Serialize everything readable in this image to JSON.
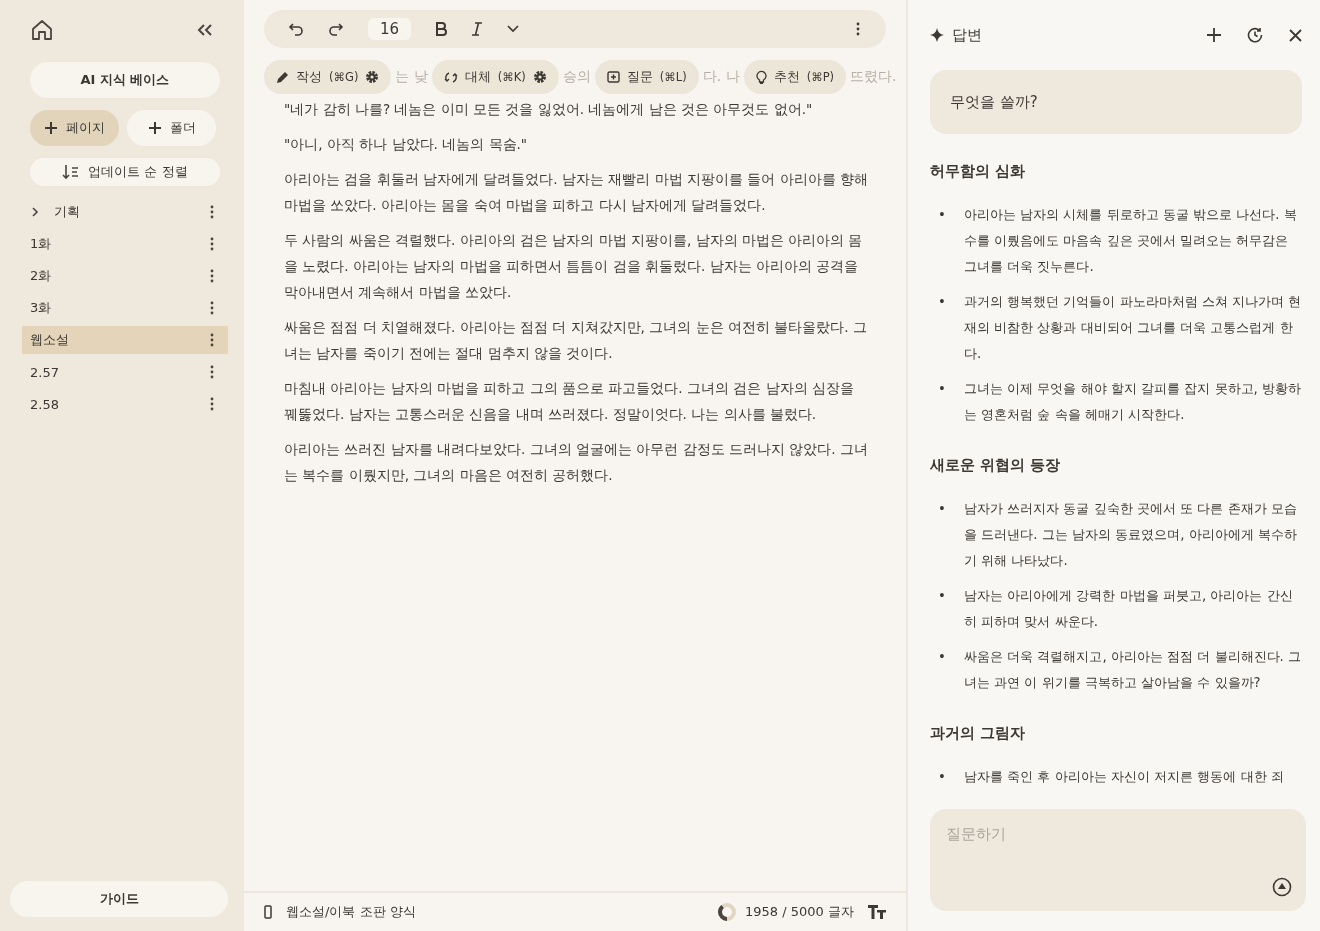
{
  "sidebar": {
    "knowledge_base_button": "AI 지식 베이스",
    "new_buttons": [
      {
        "label": "페이지",
        "selected": true
      },
      {
        "label": "폴더",
        "selected": false
      }
    ],
    "sort_button": "업데이트 순 정렬",
    "items": [
      {
        "kind": "folder",
        "label": "기획",
        "expanded": false,
        "selected": false
      },
      {
        "kind": "page",
        "label": "1화",
        "selected": false
      },
      {
        "kind": "page",
        "label": "2화",
        "selected": false
      },
      {
        "kind": "page",
        "label": "3화",
        "selected": false
      },
      {
        "kind": "page",
        "label": "웹소설",
        "selected": true
      },
      {
        "kind": "page",
        "label": "2.57",
        "selected": false
      },
      {
        "kind": "page",
        "label": "2.58",
        "selected": false
      }
    ],
    "guide_button": "가이드"
  },
  "toolbar": {
    "font_size": "16"
  },
  "ai_actions": [
    {
      "kind": "write",
      "label": "작성",
      "shortcut": "(⌘G)",
      "settings": true,
      "fragment_after": "는 낮"
    },
    {
      "kind": "replace",
      "label": "대체",
      "shortcut": "(⌘K)",
      "settings": true,
      "fragment_after": "승의"
    },
    {
      "kind": "ask",
      "label": "질문",
      "shortcut": "(⌘L)",
      "settings": false,
      "fragment_after": "다. 나"
    },
    {
      "kind": "suggest",
      "label": "추천",
      "shortcut": "(⌘P)",
      "settings": false,
      "fragment_after": "뜨렸다."
    }
  ],
  "paragraphs": [
    "\"네가 감히 나를? 네놈은 이미 모든 것을 잃었어. 네놈에게 남은 것은 아무것도 없어.\"",
    "\"아니, 아직 하나 남았다. 네놈의 목숨.\"",
    "아리아는 검을 휘둘러 남자에게 달려들었다. 남자는 재빨리 마법 지팡이를 들어 아리아를 향해 마법을 쏘았다. 아리아는 몸을 숙여 마법을 피하고 다시 남자에게 달려들었다.",
    "두 사람의 싸움은 격렬했다. 아리아의 검은 남자의 마법 지팡이를, 남자의 마법은 아리아의 몸을 노렸다. 아리아는 남자의 마법을 피하면서 틈틈이 검을 휘둘렀다. 남자는 아리아의 공격을 막아내면서 계속해서 마법을 쏘았다.",
    "싸움은 점점 더 치열해졌다. 아리아는 점점 더 지쳐갔지만, 그녀의 눈은 여전히 불타올랐다. 그녀는 남자를 죽이기 전에는 절대 멈추지 않을 것이다.",
    "마침내 아리아는 남자의 마법을 피하고 그의 품으로 파고들었다. 그녀의 검은 남자의 심장을 꿰뚫었다. 남자는 고통스러운 신음을 내며 쓰러졌다. 정말이엇다. 나는 의사를 불렀다.",
    "아리아는 쓰러진 남자를 내려다보았다. 그녀의 얼굴에는 아무런 감정도 드러나지 않았다. 그녀는 복수를 이뤘지만, 그녀의 마음은 여전히 공허했다."
  ],
  "status_bar": {
    "format": "웹소설/이북 조판 양식",
    "char_count": "1958 / 5000 글자",
    "level": 0.39
  },
  "answer_panel": {
    "title": "답변",
    "prompt": "무엇을 쓸까?",
    "sections": [
      {
        "heading": "허무함의 심화",
        "bullets": [
          {
            "marker": "•",
            "text": "아리아는 남자의 시체를 뒤로하고 동굴 밖으로 나선다. 복수를 이뤘음에도 마음속 깊은 곳에서 밀려오는 허무감은 그녀를 더욱 짓누른다."
          },
          {
            "marker": "•",
            "text": "과거의 행복했던 기억들이 파노라마처럼 스쳐 지나가며 현재의 비참한 상황과 대비되어 그녀를 더욱 고통스럽게 한다."
          },
          {
            "marker": "•",
            "text": "그녀는 이제 무엇을 해야 할지 갈피를 잡지 못하고, 방황하는 영혼처럼 숲 속을 헤매기 시작한다."
          }
        ]
      },
      {
        "heading": "새로운 위협의 등장",
        "bullets": [
          {
            "marker": "•",
            "text": "남자가 쓰러지자 동굴 깊숙한 곳에서 또 다른 존재가 모습을 드러낸다. 그는 남자의 동료였으며, 아리아에게 복수하기 위해 나타났다."
          },
          {
            "marker": "•",
            "text": "남자는 아리아에게 강력한 마법을 퍼붓고, 아리아는 간신히 피하며 맞서 싸운다."
          },
          {
            "marker": "•",
            "text": "싸움은 더욱 격렬해지고, 아리아는 점점 더 불리해진다. 그녀는 과연 이 위기를 극복하고 살아남을 수 있을까?"
          }
        ]
      },
      {
        "heading": "과거의 그림자",
        "bullets": [
          {
            "marker": "•",
            "text": "남자를 죽인 후 아리아는 자신이 저지른 행동에 대한 죄"
          }
        ]
      }
    ],
    "input": {
      "placeholder": "질문하기"
    }
  }
}
